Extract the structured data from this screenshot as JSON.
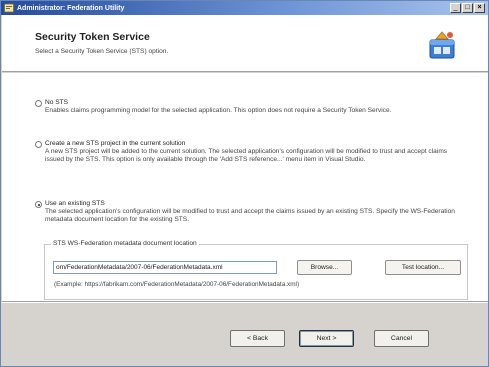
{
  "window": {
    "title": "Administrator: Federation Utility",
    "buttons": [
      "_",
      "□",
      "×"
    ]
  },
  "header": {
    "title": "Security Token Service",
    "subtitle": "Select a Security Token Service (STS) option.",
    "art_icon": "sts-wizard-icon"
  },
  "options": [
    {
      "label": "No STS",
      "selected": false,
      "description": "Enables claims programming model for the selected application. This option does not require a Security Token Service."
    },
    {
      "label": "Create a new STS project in the current solution",
      "selected": false,
      "description": "A new STS project will be added to the current solution. The selected application's configuration will be modified to trust and accept claims issued by the STS. This option is only available through the 'Add STS reference...' menu item in Visual Studio."
    },
    {
      "label": "Use an existing STS",
      "selected": true,
      "description": "The selected application's configuration will be modified to trust and accept the claims issued by an existing STS. Specify the WS-Federation metadata document location for the existing STS."
    }
  ],
  "metadata": {
    "legend": "STS WS-Federation metadata document location",
    "value": "om/FederationMetadata/2007-06/FederationMetadata.xml",
    "browse_label": "Browse...",
    "test_label": "Test location...",
    "example": "(Example: https://fabrikam.com/FederationMetadata/2007-06/FederationMetadata.xml)"
  },
  "footer": {
    "back_label": "< Back",
    "next_label": "Next >",
    "cancel_label": "Cancel"
  },
  "colors": {
    "titlebar_start": "#244c9c",
    "titlebar_end": "#a9c4ec",
    "dialog_face": "#d6d3ce"
  }
}
